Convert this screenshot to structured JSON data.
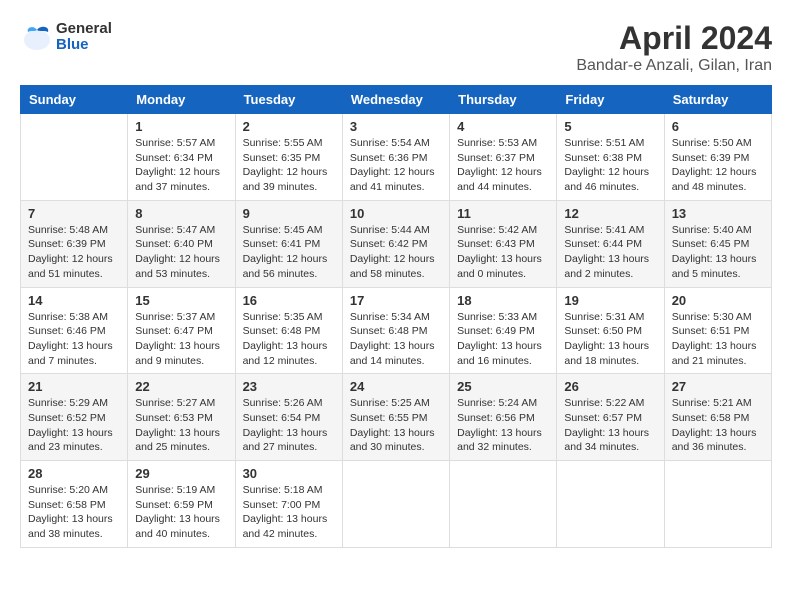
{
  "header": {
    "logo_line1": "General",
    "logo_line2": "Blue",
    "title": "April 2024",
    "subtitle": "Bandar-e Anzali, Gilan, Iran"
  },
  "calendar": {
    "days_of_week": [
      "Sunday",
      "Monday",
      "Tuesday",
      "Wednesday",
      "Thursday",
      "Friday",
      "Saturday"
    ],
    "weeks": [
      [
        {
          "day": "",
          "info": ""
        },
        {
          "day": "1",
          "info": "Sunrise: 5:57 AM\nSunset: 6:34 PM\nDaylight: 12 hours\nand 37 minutes."
        },
        {
          "day": "2",
          "info": "Sunrise: 5:55 AM\nSunset: 6:35 PM\nDaylight: 12 hours\nand 39 minutes."
        },
        {
          "day": "3",
          "info": "Sunrise: 5:54 AM\nSunset: 6:36 PM\nDaylight: 12 hours\nand 41 minutes."
        },
        {
          "day": "4",
          "info": "Sunrise: 5:53 AM\nSunset: 6:37 PM\nDaylight: 12 hours\nand 44 minutes."
        },
        {
          "day": "5",
          "info": "Sunrise: 5:51 AM\nSunset: 6:38 PM\nDaylight: 12 hours\nand 46 minutes."
        },
        {
          "day": "6",
          "info": "Sunrise: 5:50 AM\nSunset: 6:39 PM\nDaylight: 12 hours\nand 48 minutes."
        }
      ],
      [
        {
          "day": "7",
          "info": "Sunrise: 5:48 AM\nSunset: 6:39 PM\nDaylight: 12 hours\nand 51 minutes."
        },
        {
          "day": "8",
          "info": "Sunrise: 5:47 AM\nSunset: 6:40 PM\nDaylight: 12 hours\nand 53 minutes."
        },
        {
          "day": "9",
          "info": "Sunrise: 5:45 AM\nSunset: 6:41 PM\nDaylight: 12 hours\nand 56 minutes."
        },
        {
          "day": "10",
          "info": "Sunrise: 5:44 AM\nSunset: 6:42 PM\nDaylight: 12 hours\nand 58 minutes."
        },
        {
          "day": "11",
          "info": "Sunrise: 5:42 AM\nSunset: 6:43 PM\nDaylight: 13 hours\nand 0 minutes."
        },
        {
          "day": "12",
          "info": "Sunrise: 5:41 AM\nSunset: 6:44 PM\nDaylight: 13 hours\nand 2 minutes."
        },
        {
          "day": "13",
          "info": "Sunrise: 5:40 AM\nSunset: 6:45 PM\nDaylight: 13 hours\nand 5 minutes."
        }
      ],
      [
        {
          "day": "14",
          "info": "Sunrise: 5:38 AM\nSunset: 6:46 PM\nDaylight: 13 hours\nand 7 minutes."
        },
        {
          "day": "15",
          "info": "Sunrise: 5:37 AM\nSunset: 6:47 PM\nDaylight: 13 hours\nand 9 minutes."
        },
        {
          "day": "16",
          "info": "Sunrise: 5:35 AM\nSunset: 6:48 PM\nDaylight: 13 hours\nand 12 minutes."
        },
        {
          "day": "17",
          "info": "Sunrise: 5:34 AM\nSunset: 6:48 PM\nDaylight: 13 hours\nand 14 minutes."
        },
        {
          "day": "18",
          "info": "Sunrise: 5:33 AM\nSunset: 6:49 PM\nDaylight: 13 hours\nand 16 minutes."
        },
        {
          "day": "19",
          "info": "Sunrise: 5:31 AM\nSunset: 6:50 PM\nDaylight: 13 hours\nand 18 minutes."
        },
        {
          "day": "20",
          "info": "Sunrise: 5:30 AM\nSunset: 6:51 PM\nDaylight: 13 hours\nand 21 minutes."
        }
      ],
      [
        {
          "day": "21",
          "info": "Sunrise: 5:29 AM\nSunset: 6:52 PM\nDaylight: 13 hours\nand 23 minutes."
        },
        {
          "day": "22",
          "info": "Sunrise: 5:27 AM\nSunset: 6:53 PM\nDaylight: 13 hours\nand 25 minutes."
        },
        {
          "day": "23",
          "info": "Sunrise: 5:26 AM\nSunset: 6:54 PM\nDaylight: 13 hours\nand 27 minutes."
        },
        {
          "day": "24",
          "info": "Sunrise: 5:25 AM\nSunset: 6:55 PM\nDaylight: 13 hours\nand 30 minutes."
        },
        {
          "day": "25",
          "info": "Sunrise: 5:24 AM\nSunset: 6:56 PM\nDaylight: 13 hours\nand 32 minutes."
        },
        {
          "day": "26",
          "info": "Sunrise: 5:22 AM\nSunset: 6:57 PM\nDaylight: 13 hours\nand 34 minutes."
        },
        {
          "day": "27",
          "info": "Sunrise: 5:21 AM\nSunset: 6:58 PM\nDaylight: 13 hours\nand 36 minutes."
        }
      ],
      [
        {
          "day": "28",
          "info": "Sunrise: 5:20 AM\nSunset: 6:58 PM\nDaylight: 13 hours\nand 38 minutes."
        },
        {
          "day": "29",
          "info": "Sunrise: 5:19 AM\nSunset: 6:59 PM\nDaylight: 13 hours\nand 40 minutes."
        },
        {
          "day": "30",
          "info": "Sunrise: 5:18 AM\nSunset: 7:00 PM\nDaylight: 13 hours\nand 42 minutes."
        },
        {
          "day": "",
          "info": ""
        },
        {
          "day": "",
          "info": ""
        },
        {
          "day": "",
          "info": ""
        },
        {
          "day": "",
          "info": ""
        }
      ]
    ]
  }
}
